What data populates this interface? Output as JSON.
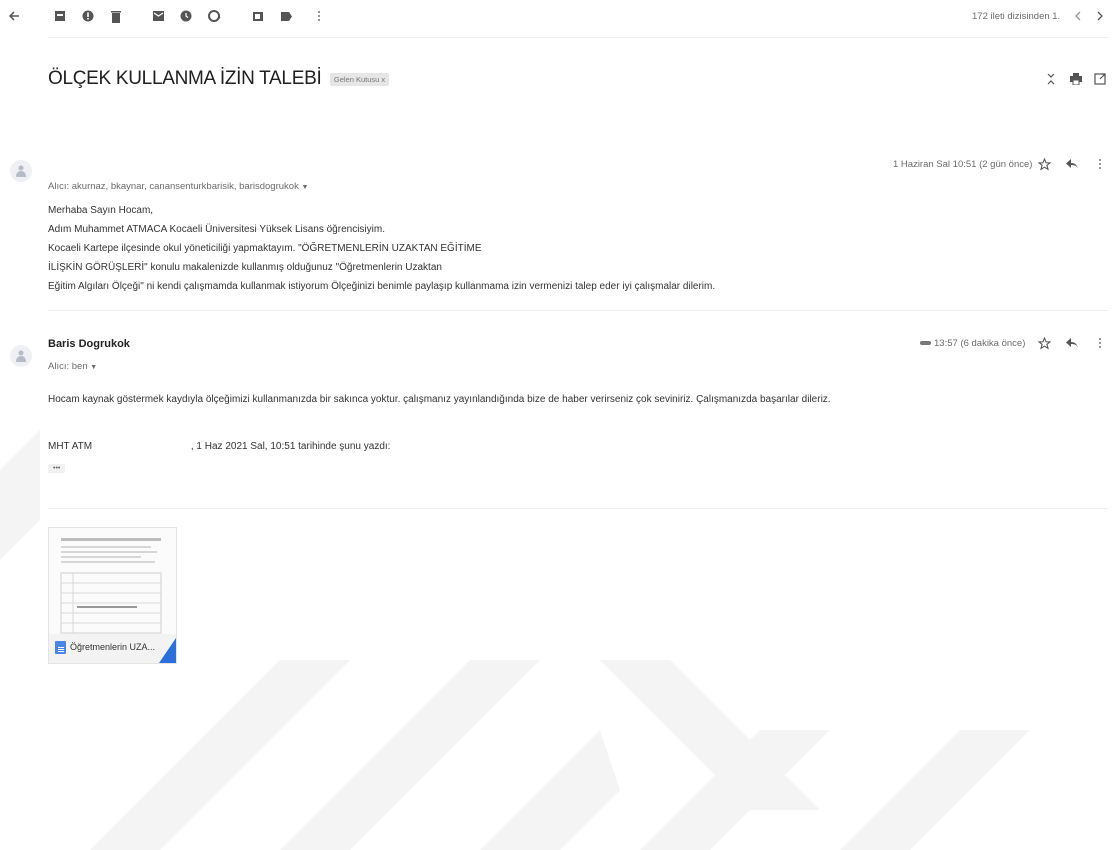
{
  "toolbar": {
    "pagination": "172 ileti dizisinden 1.",
    "icons": [
      "back-arrow-icon",
      "archive-icon",
      "report-spam-icon",
      "delete-icon",
      "mark-unread-icon",
      "snooze-icon",
      "add-task-icon",
      "move-to-icon",
      "label-icon",
      "more-vert-icon",
      "prev-icon",
      "next-icon"
    ]
  },
  "subject": {
    "title": "ÖLÇEK KULLANMA İZİN TALEBİ",
    "label": "Gelen Kutusu x"
  },
  "message1": {
    "date": "1 Haziran Sal 10:51 (2 gün önce)",
    "recipients": "Alıcı: akurnaz, bkaynar, canansenturkbarisik, barisdogrukok",
    "lines": [
      "Merhaba Sayın Hocam,",
      "Adım Muhammet ATMACA Kocaeli Üniversitesi Yüksek Lisans öğrencisiyim.",
      "Kocaeli Kartepe ilçesinde okul yöneticiliği yapmaktayım. \"ÖĞRETMENLERİN UZAKTAN EĞİTİME",
      "İLİŞKİN GÖRÜŞLERİ\" konulu makalenizde kullanmış olduğunuz \"Öğretmenlerin Uzaktan",
      "Eğitim Algıları Ölçeği\" ni kendi çalışmamda kullanmak istiyorum Ölçeğinizi benimle paylaşıp kullanmama izin vermenizi talep eder iyi çalışmalar dilerim."
    ]
  },
  "message2": {
    "sender": "Baris Dogrukok",
    "recipient": "Alıcı: ben",
    "date": "13:57 (6 dakika önce)",
    "body": "Hocam kaynak göstermek kaydıyla ölçeğimizi kullanmanızda bir sakınca yoktur. çalışmanız yayınlandığında bize de haber verirseniz çok seviniriz.  Çalışmanızda başarılar dileriz.",
    "quote_name": "MHT ATM",
    "quote_header": ", 1 Haz 2021 Sal, 10:51 tarihinde şunu yazdı:",
    "ellipsis": "•••"
  },
  "attachment": {
    "name": "Öğretmenlerin UZA..."
  },
  "colors": {
    "doc_blue": "#4a86e8",
    "attachment_corner": "#2a6fdb",
    "watermark": "#f3f3f3"
  }
}
